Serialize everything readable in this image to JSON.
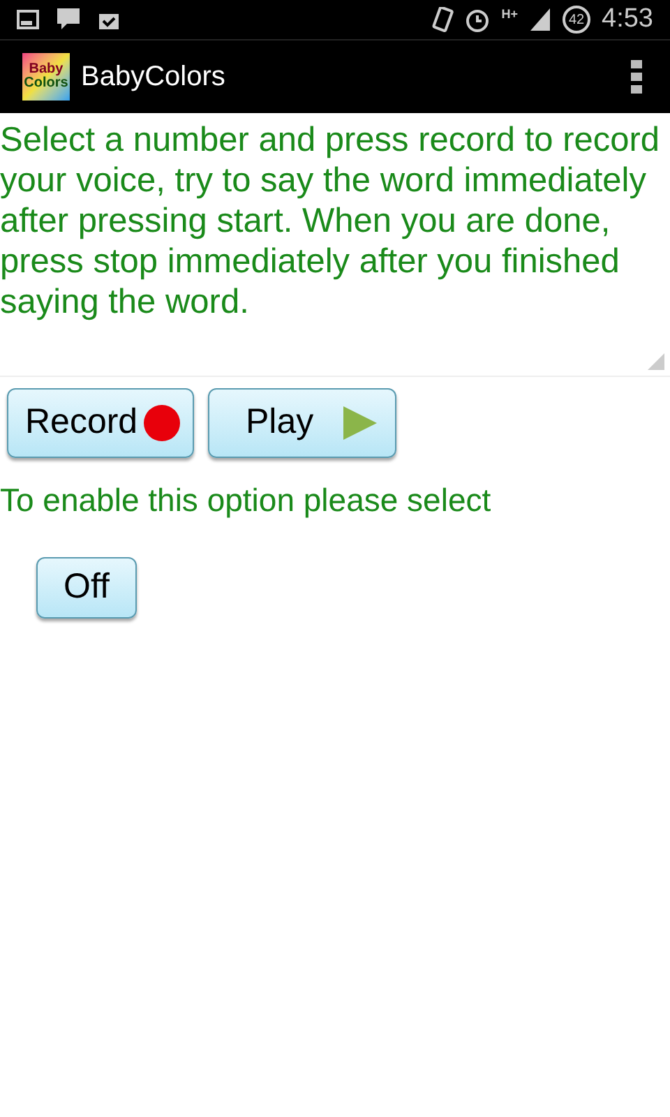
{
  "status_bar": {
    "network": "H+",
    "battery": "42",
    "time": "4:53"
  },
  "action_bar": {
    "logo_text": [
      "Baby",
      "Colors"
    ],
    "title": "BabyColors"
  },
  "instructions": "Select a number and press record to record your voice, try to say the word immediately after pressing start. When you are done, press stop immediately after you finished saying the word.",
  "buttons": [
    {
      "kind": "record",
      "label": "Record"
    },
    {
      "kind": "play",
      "label": "Play"
    }
  ],
  "option_label": "To enable this option please select",
  "toggle": {
    "label": "Off",
    "on": false
  }
}
